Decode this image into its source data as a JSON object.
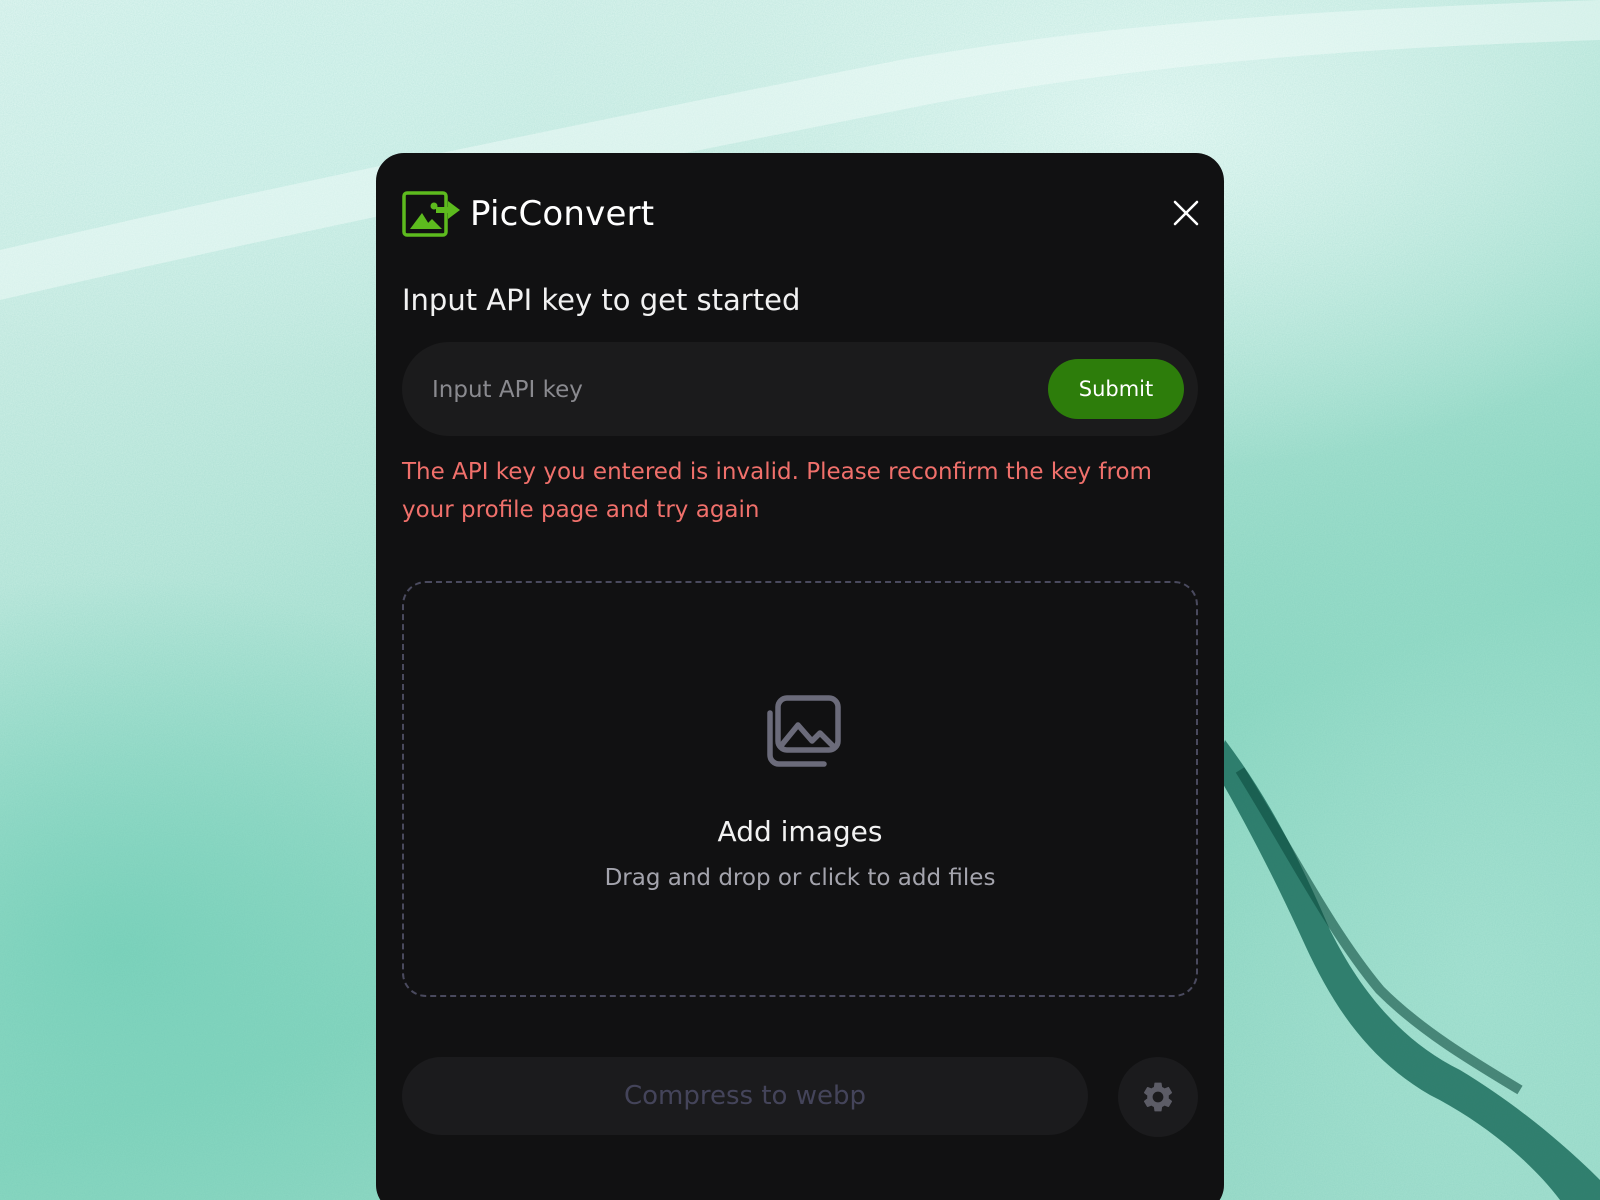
{
  "app": {
    "title": "PicConvert",
    "logo_icon": "image-convert-icon",
    "accent_color": "#2d7d0b",
    "logo_color": "#5dbb1e"
  },
  "header": {
    "close_icon": "close-icon"
  },
  "api_key": {
    "prompt": "Input API key to get started",
    "placeholder": "Input API key",
    "value": "",
    "submit_label": "Submit",
    "error_message": "The API key you entered is invalid. Please reconfirm the key from your profile page and try again",
    "error_color": "#f0706b"
  },
  "dropzone": {
    "icon": "images-icon",
    "title": "Add images",
    "subtitle": "Drag and drop or click to add files"
  },
  "actions": {
    "compress_label": "Compress to webp",
    "compress_enabled": false,
    "settings_icon": "gear-icon"
  }
}
